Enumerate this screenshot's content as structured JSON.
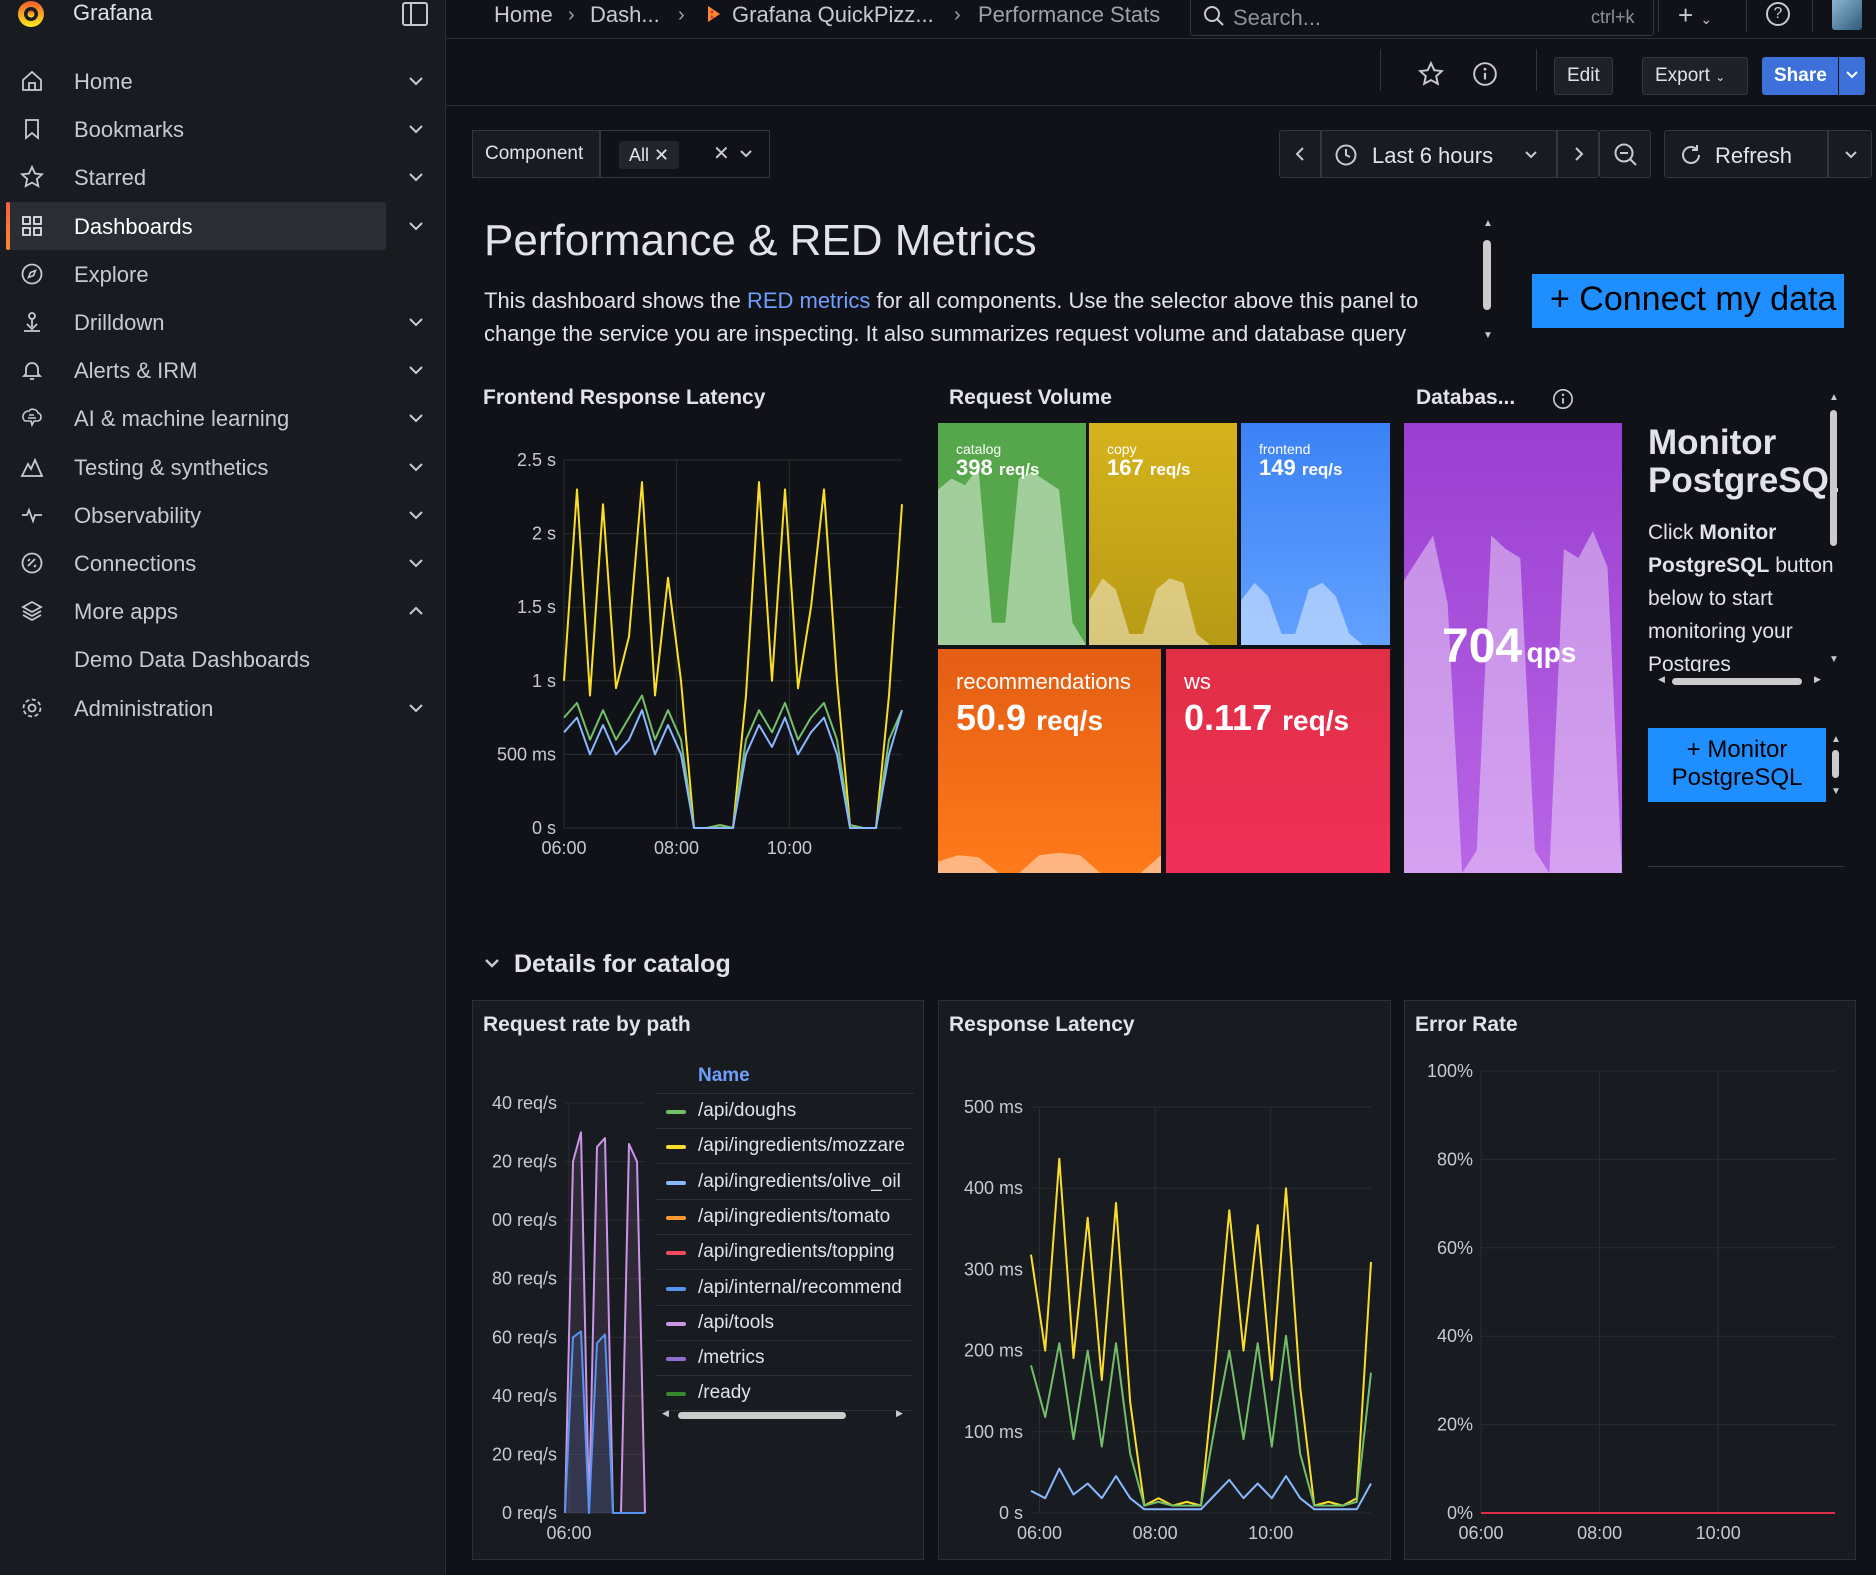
{
  "app": {
    "brand": "Grafana"
  },
  "breadcrumbs": [
    "Home",
    "Dash...",
    "Grafana QuickPizz...",
    "Performance Stats"
  ],
  "search": {
    "placeholder": "Search...",
    "shortcut": "ctrl+k"
  },
  "nav": {
    "items": [
      {
        "label": "Home",
        "icon": "home-icon",
        "chevron": "down"
      },
      {
        "label": "Bookmarks",
        "icon": "bookmark-icon",
        "chevron": "down"
      },
      {
        "label": "Starred",
        "icon": "star-icon",
        "chevron": "down"
      },
      {
        "label": "Dashboards",
        "icon": "dashboards-icon",
        "chevron": "down",
        "active": true
      },
      {
        "label": "Explore",
        "icon": "compass-icon",
        "chevron": ""
      },
      {
        "label": "Drilldown",
        "icon": "drilldown-icon",
        "chevron": "down"
      },
      {
        "label": "Alerts & IRM",
        "icon": "bell-icon",
        "chevron": "down"
      },
      {
        "label": "AI & machine learning",
        "icon": "brain-icon",
        "chevron": "down"
      },
      {
        "label": "Testing & synthetics",
        "icon": "k6-icon",
        "chevron": "down"
      },
      {
        "label": "Observability",
        "icon": "heartbeat-icon",
        "chevron": "down"
      },
      {
        "label": "Connections",
        "icon": "connections-icon",
        "chevron": "down"
      },
      {
        "label": "More apps",
        "icon": "layers-icon",
        "chevron": "up"
      },
      {
        "label": "Demo Data Dashboards",
        "icon": "",
        "chevron": ""
      },
      {
        "label": "Administration",
        "icon": "gear-icon",
        "chevron": "down"
      }
    ]
  },
  "toolbar": {
    "edit": "Edit",
    "export": "Export",
    "share": "Share"
  },
  "variables": {
    "label": "Component",
    "value": "All"
  },
  "time": {
    "range": "Last 6 hours",
    "refresh": "Refresh"
  },
  "text_panel": {
    "title": "Performance & RED Metrics",
    "body_before": "This dashboard shows the ",
    "link": "RED metrics",
    "body_after": " for all components. Use the selector above this panel to change the service you are inspecting. It also summarizes request volume and database query"
  },
  "connect_button": "+ Connect my data",
  "panels": {
    "latency": {
      "title": "Frontend Response Latency"
    },
    "volume": {
      "title": "Request Volume"
    },
    "database": {
      "title": "Databas...",
      "value": "704",
      "unit": "qps"
    },
    "request_rate": {
      "title": "Request rate by path",
      "legend_header": "Name"
    },
    "response_latency": {
      "title": "Response Latency"
    },
    "error_rate": {
      "title": "Error Rate"
    }
  },
  "stat_tiles": [
    {
      "name": "catalog",
      "value": "398",
      "unit": "req/s",
      "color_top": "#56a64b",
      "color_bottom": "#56a64b"
    },
    {
      "name": "copy",
      "value": "167",
      "unit": "req/s",
      "color_top": "#d6b31c",
      "color_bottom": "#b79a15"
    },
    {
      "name": "frontend",
      "value": "149",
      "unit": "req/s",
      "color_top": "#3b82f6",
      "color_bottom": "#62a1ff"
    },
    {
      "name": "recommendations",
      "value": "50.9",
      "unit": "req/s",
      "color_top": "#e35d14",
      "color_bottom": "#ff7a1a"
    },
    {
      "name": "ws",
      "value": "0.117",
      "unit": "req/s",
      "color_top": "#e02f44",
      "color_bottom": "#f0305a"
    }
  ],
  "monitor": {
    "title": "Monitor PostgreSQL",
    "body_prefix": "Click ",
    "body_bold": "Monitor PostgreSQL",
    "body_suffix": " button below to start monitoring your Postgres",
    "button": "+ Monitor PostgreSQL"
  },
  "row": {
    "title": "Details for catalog"
  },
  "legend": [
    {
      "name": "/api/doughs",
      "color": "#73bf69"
    },
    {
      "name": "/api/ingredients/mozzare",
      "color": "#fade2a"
    },
    {
      "name": "/api/ingredients/olive_oil",
      "color": "#8ab8ff"
    },
    {
      "name": "/api/ingredients/tomato",
      "color": "#ff9830"
    },
    {
      "name": "/api/ingredients/topping",
      "color": "#f2495c"
    },
    {
      "name": "/api/internal/recommend",
      "color": "#5794f2"
    },
    {
      "name": "/api/tools",
      "color": "#ca95e5"
    },
    {
      "name": "/metrics",
      "color": "#8f6ed5"
    },
    {
      "name": "/ready",
      "color": "#37872d"
    }
  ],
  "chart_data": [
    {
      "type": "line",
      "title": "Frontend Response Latency",
      "x_ticks": [
        "06:00",
        "08:00",
        "10:00"
      ],
      "y_ticks": [
        "0 s",
        "500 ms",
        "1 s",
        "1.5 s",
        "2 s",
        "2.5 s"
      ],
      "ylim": [
        0,
        2.5
      ],
      "y_unit": "s",
      "series": [
        {
          "color": "#fade2a",
          "values": [
            1.0,
            2.3,
            0.9,
            2.2,
            0.95,
            1.3,
            2.35,
            0.9,
            1.7,
            1.0,
            0.0,
            0.0,
            0.02,
            0.0,
            0.9,
            2.35,
            1.0,
            2.3,
            0.95,
            1.5,
            2.3,
            1.0,
            0.02,
            0.0,
            0.0,
            0.9,
            2.2
          ]
        },
        {
          "color": "#73bf69",
          "values": [
            0.75,
            0.85,
            0.6,
            0.8,
            0.6,
            0.75,
            0.9,
            0.6,
            0.8,
            0.6,
            0.0,
            0.0,
            0.02,
            0.0,
            0.6,
            0.8,
            0.65,
            0.85,
            0.6,
            0.75,
            0.85,
            0.6,
            0.02,
            0.0,
            0.0,
            0.6,
            0.8
          ]
        },
        {
          "color": "#8ab8ff",
          "values": [
            0.65,
            0.75,
            0.5,
            0.7,
            0.5,
            0.6,
            0.8,
            0.5,
            0.7,
            0.5,
            0.0,
            0.0,
            0.0,
            0.0,
            0.5,
            0.7,
            0.55,
            0.75,
            0.5,
            0.65,
            0.75,
            0.5,
            0.0,
            0.0,
            0.0,
            0.5,
            0.8
          ]
        }
      ]
    },
    {
      "type": "area",
      "title": "Request rate by path",
      "x_ticks": [
        "06:00"
      ],
      "y_ticks": [
        "0 req/s",
        "20 req/s",
        "40 req/s",
        "60 req/s",
        "80 req/s",
        "00 req/s",
        "20 req/s",
        "40 req/s"
      ],
      "series": [
        {
          "color": "#ca95e5",
          "values": [
            0,
            120,
            130,
            0,
            125,
            128,
            0,
            0,
            126,
            120,
            0
          ]
        },
        {
          "color": "#5794f2",
          "values": [
            0,
            60,
            62,
            0,
            58,
            61,
            0,
            0,
            0,
            0,
            0
          ]
        }
      ]
    },
    {
      "type": "line",
      "title": "Response Latency",
      "x_ticks": [
        "06:00",
        "08:00",
        "10:00"
      ],
      "y_ticks": [
        "0 s",
        "100 ms",
        "200 ms",
        "300 ms",
        "400 ms",
        "500 ms"
      ],
      "ylim": [
        0,
        550
      ],
      "series": [
        {
          "color": "#fade2a",
          "values": [
            350,
            220,
            480,
            210,
            400,
            180,
            420,
            150,
            10,
            20,
            10,
            15,
            10,
            200,
            410,
            220,
            390,
            180,
            440,
            170,
            10,
            15,
            10,
            20,
            340
          ]
        },
        {
          "color": "#73bf69",
          "values": [
            200,
            130,
            230,
            100,
            220,
            90,
            230,
            80,
            10,
            15,
            10,
            10,
            10,
            120,
            220,
            100,
            230,
            90,
            240,
            80,
            10,
            10,
            10,
            15,
            190
          ]
        },
        {
          "color": "#8ab8ff",
          "values": [
            30,
            20,
            60,
            25,
            40,
            20,
            50,
            20,
            5,
            5,
            5,
            5,
            5,
            25,
            45,
            20,
            40,
            20,
            50,
            20,
            5,
            5,
            5,
            5,
            40
          ]
        }
      ]
    },
    {
      "type": "line",
      "title": "Error Rate",
      "x_ticks": [
        "06:00",
        "08:00",
        "10:00"
      ],
      "y_ticks": [
        "0%",
        "20%",
        "40%",
        "60%",
        "80%",
        "100%"
      ],
      "ylim": [
        0,
        100
      ],
      "series": [
        {
          "color": "#e02f44",
          "values": [
            0,
            0,
            0,
            0,
            0,
            0,
            0,
            0,
            0,
            0
          ]
        }
      ]
    }
  ]
}
